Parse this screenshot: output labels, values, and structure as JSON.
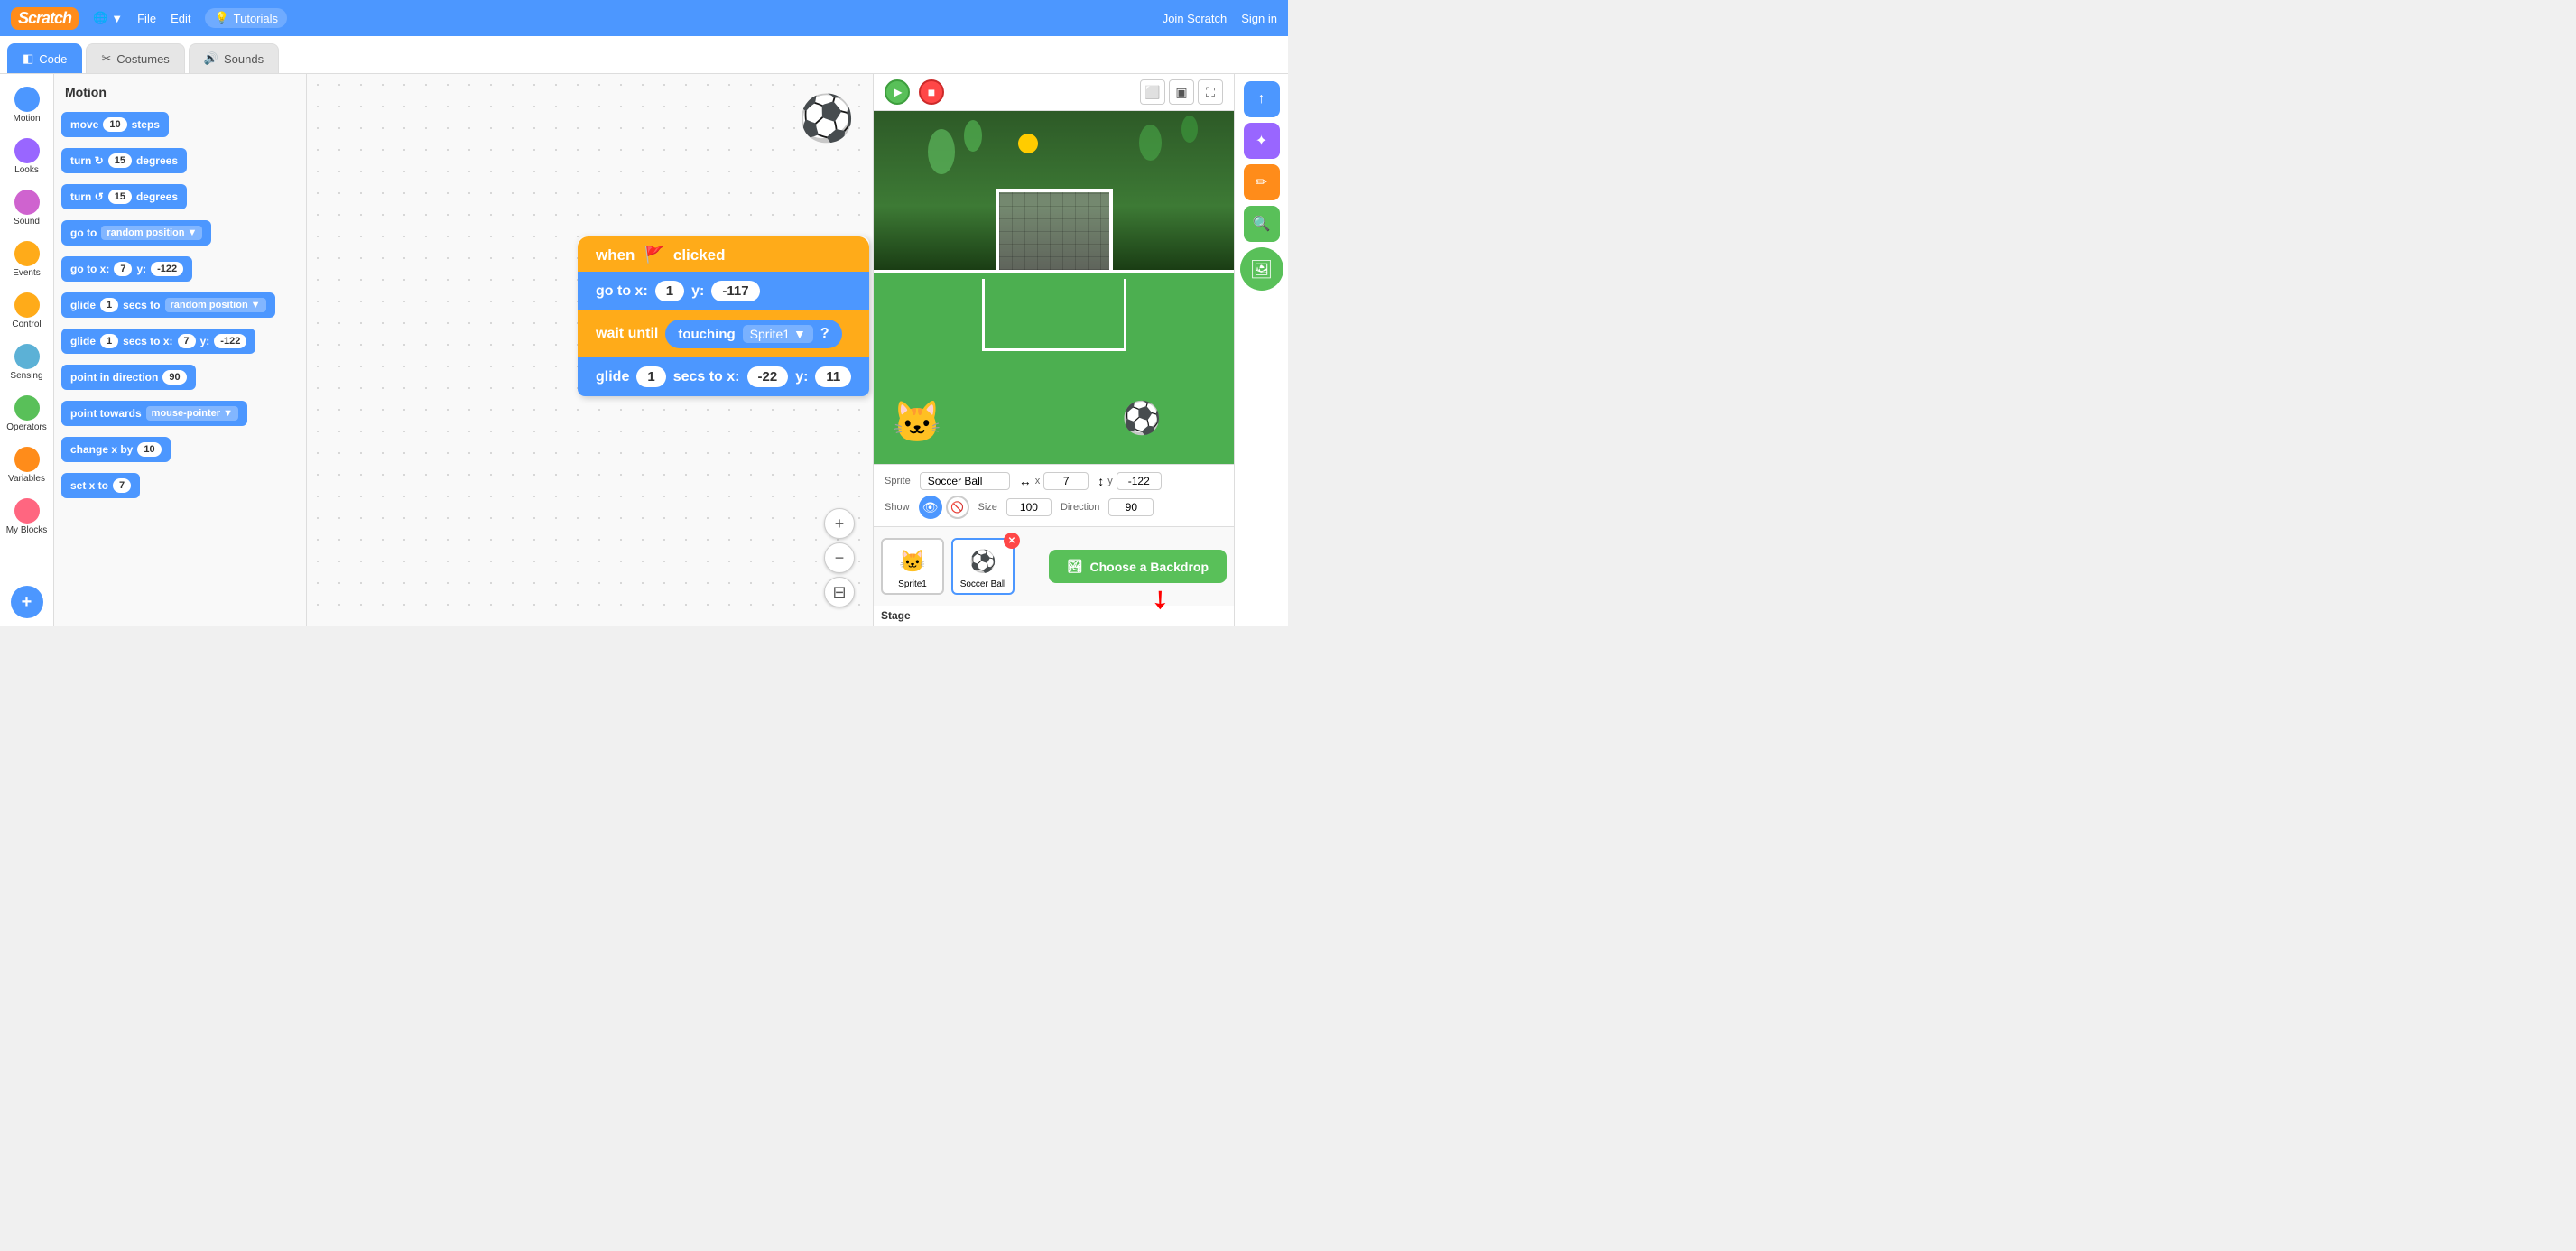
{
  "nav": {
    "logo": "Scratch",
    "globe_label": "🌐",
    "file_label": "File",
    "edit_label": "Edit",
    "tutorials_icon": "💡",
    "tutorials_label": "Tutorials",
    "join_label": "Join Scratch",
    "signin_label": "Sign in"
  },
  "tabs": {
    "code": "Code",
    "costumes": "Costumes",
    "sounds": "Sounds"
  },
  "sidebar": {
    "items": [
      {
        "label": "Motion",
        "color": "#4c97ff"
      },
      {
        "label": "Looks",
        "color": "#9966ff"
      },
      {
        "label": "Sound",
        "color": "#cf63cf"
      },
      {
        "label": "Events",
        "color": "#ffab19"
      },
      {
        "label": "Control",
        "color": "#ffab19"
      },
      {
        "label": "Sensing",
        "color": "#5cb1d6"
      },
      {
        "label": "Operators",
        "color": "#59c059"
      },
      {
        "label": "Variables",
        "color": "#ff8c1a"
      },
      {
        "label": "My Blocks",
        "color": "#ff6680"
      }
    ]
  },
  "blocks_panel": {
    "title": "Motion",
    "blocks": [
      {
        "text": "move",
        "value": "10",
        "suffix": "steps"
      },
      {
        "text": "turn ↻",
        "value": "15",
        "suffix": "degrees"
      },
      {
        "text": "turn ↺",
        "value": "15",
        "suffix": "degrees"
      },
      {
        "text": "go to",
        "dropdown": "random position"
      },
      {
        "text": "go to x:",
        "value1": "7",
        "label2": "y:",
        "value2": "-122"
      },
      {
        "text": "glide",
        "value": "1",
        "mid": "secs to",
        "dropdown": "random position"
      },
      {
        "text": "glide",
        "value": "1",
        "mid": "secs to x:",
        "value2": "7",
        "label2": "y:",
        "value3": "-122"
      },
      {
        "text": "point in direction",
        "value": "90"
      },
      {
        "text": "point towards",
        "dropdown": "mouse-pointer"
      },
      {
        "text": "change x by",
        "value": "10"
      },
      {
        "text": "set x to",
        "value": "7"
      }
    ]
  },
  "script": {
    "hat_label": "when",
    "hat_flag": "🚩",
    "hat_suffix": "clicked",
    "goto_label": "go to x:",
    "goto_x": "1",
    "goto_y_label": "y:",
    "goto_y": "-117",
    "wait_label": "wait until",
    "touch_label": "touching",
    "touch_sprite": "Sprite1",
    "wait_q": "?",
    "glide_label": "glide",
    "glide_val": "1",
    "glide_mid": "secs to x:",
    "glide_x": "-22",
    "glide_y_label": "y:",
    "glide_y": "11"
  },
  "stage": {
    "sprite_label": "Sprite",
    "sprite_name": "Soccer Ball",
    "x_label": "x",
    "x_value": "7",
    "y_label": "y",
    "y_value": "-122",
    "show_label": "Show",
    "size_label": "Size",
    "size_value": "100",
    "direction_label": "Direction",
    "direction_value": "90",
    "stage_label": "Stage"
  },
  "sprites": [
    {
      "name": "Sprite1",
      "emoji": "🐱",
      "selected": false
    },
    {
      "name": "Soccer Ball",
      "emoji": "⚽",
      "selected": true
    }
  ],
  "choose_backdrop_label": "Choose a Backdrop",
  "zoom": {
    "plus": "+",
    "minus": "−",
    "fit": "⊟"
  }
}
